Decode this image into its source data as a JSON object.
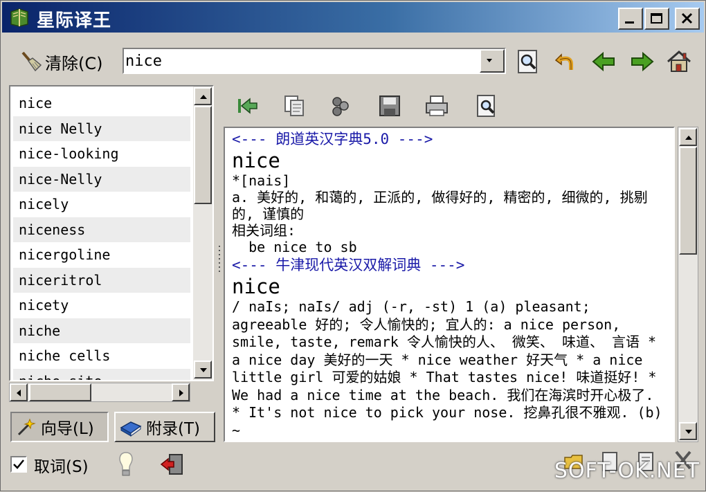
{
  "window": {
    "title": "星际译王",
    "controls": [
      "minimize",
      "maximize",
      "close"
    ]
  },
  "toolbar": {
    "clear_label": "清除(C)",
    "search_value": "nice",
    "icons": [
      "search-icon",
      "back-undo-icon",
      "back-arrow-icon",
      "forward-arrow-icon",
      "home-icon"
    ]
  },
  "wordlist": {
    "items": [
      "nice",
      "nice Nelly",
      "nice-looking",
      "nice-Nelly",
      "nicely",
      "niceness",
      "nicergoline",
      "niceritrol",
      "nicety",
      "niche",
      "niche cells",
      "niche-site"
    ]
  },
  "tabs": {
    "guide_label": "向导(L)",
    "appendix_label": "附录(T)"
  },
  "result_toolbar": {
    "icons": [
      "go-first-icon",
      "copy-icon",
      "pronounce-icon",
      "save-icon",
      "print-icon",
      "find-icon"
    ]
  },
  "definition": {
    "dict1_header": "<--- 朗道英汉字典5.0 --->",
    "dict1_word": "nice",
    "dict1_phonetic": "*[nais]",
    "dict1_meaning": "a. 美好的, 和蔼的, 正派的, 做得好的, 精密的, 细微的, 挑剔的, 谨慎的",
    "dict1_related_label": "相关词组:",
    "dict1_phrase": "  be nice to sb",
    "dict2_header": "<--- 牛津现代英汉双解词典 --->",
    "dict2_word": "nice",
    "dict2_body": "/ naIs; naIs/ adj (-r, -st)  1 (a) pleasant; agreeable 好的; 令人愉快的; 宜人的: a nice person, smile, taste, remark 令人愉快的人、 微笑、 味道、 言语 * a nice day 美好的一天 * nice weather 好天气 * a nice little girl 可爱的姑娘 * That tastes nice! 味道挺好! * We had a nice time at the beach. 我们在海滨时开心极了. * It's not nice to pick your nose. 挖鼻孔很不雅观. (b) ~"
  },
  "bottom": {
    "checkbox_label": "取词(S)",
    "checked": true,
    "watermark": "SOFT-OK.NET"
  }
}
